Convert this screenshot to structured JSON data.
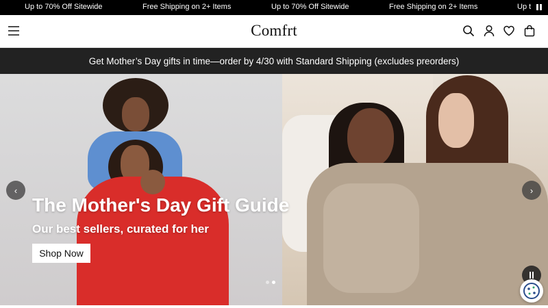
{
  "ticker": {
    "messages": [
      "Up to 70% Off Sitewide",
      "Free Shipping on 2+ Items",
      "Up to 70% Off Sitewide",
      "Free Shipping on 2+ Items",
      "Up t"
    ]
  },
  "header": {
    "logo": "Comfrt",
    "icons": [
      "hamburger-menu-icon",
      "search-icon",
      "account-icon",
      "wishlist-heart-icon",
      "shopping-bag-icon"
    ]
  },
  "promo": {
    "text": "Get Mother’s Day gifts in time—order by 4/30 with Standard Shipping (excludes preorders)"
  },
  "hero": {
    "title": "The Mother's Day Gift Guide",
    "subtitle": "Our best sellers, curated for her",
    "cta": "Shop Now",
    "prev": "‹",
    "next": "›",
    "slide_count": 2,
    "active_slide": 2
  },
  "colors": {
    "ticker_bg": "#000000",
    "promo_bg": "#222222",
    "text_dark": "#111111"
  }
}
